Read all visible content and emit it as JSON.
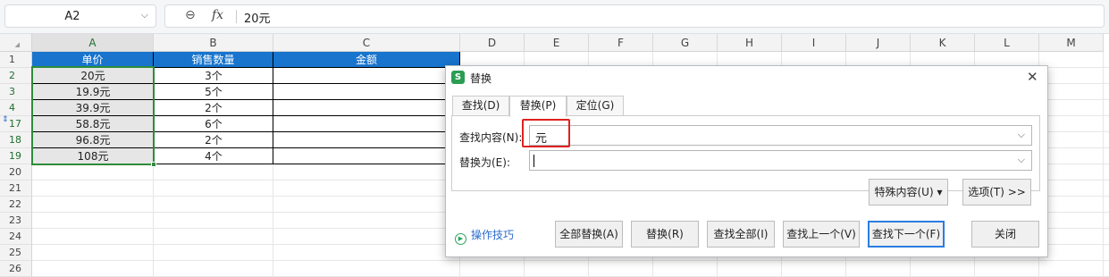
{
  "formula_bar": {
    "name_box": "A2",
    "dropdown_icon": "chevron-down-icon",
    "zoom_icon": "magnifier-icon",
    "fx": "fx",
    "value": "20元"
  },
  "sheet": {
    "columns": [
      "A",
      "B",
      "C",
      "D",
      "E",
      "F",
      "G",
      "H",
      "I",
      "J",
      "K",
      "L",
      "M"
    ],
    "rows": [
      "1",
      "2",
      "3",
      "4",
      "17",
      "18",
      "19",
      "20",
      "21",
      "22",
      "23",
      "24",
      "25",
      "26"
    ],
    "header_row": [
      "单价",
      "销售数量",
      "金额"
    ],
    "data": [
      [
        "20元",
        "3个",
        ""
      ],
      [
        "19.9元",
        "5个",
        ""
      ],
      [
        "39.9元",
        "2个",
        ""
      ],
      [
        "58.8元",
        "6个",
        ""
      ],
      [
        "96.8元",
        "2个",
        ""
      ],
      [
        "108元",
        "4个",
        ""
      ]
    ],
    "header_fill": "#1874cd"
  },
  "dialog": {
    "title": "替换",
    "logo": "S",
    "tabs": [
      "查找(D)",
      "替换(P)",
      "定位(G)"
    ],
    "find_label": "查找内容(N):",
    "find_value": "元",
    "replace_label": "替换为(E):",
    "replace_value": "",
    "special_btn": "特殊内容(U) ▾",
    "options_btn": "选项(T) >>",
    "tips": "操作技巧",
    "buttons": [
      "全部替换(A)",
      "替换(R)",
      "查找全部(I)",
      "查找上一个(V)",
      "查找下一个(F)",
      "关闭"
    ],
    "highlight_color": "#e02020"
  }
}
